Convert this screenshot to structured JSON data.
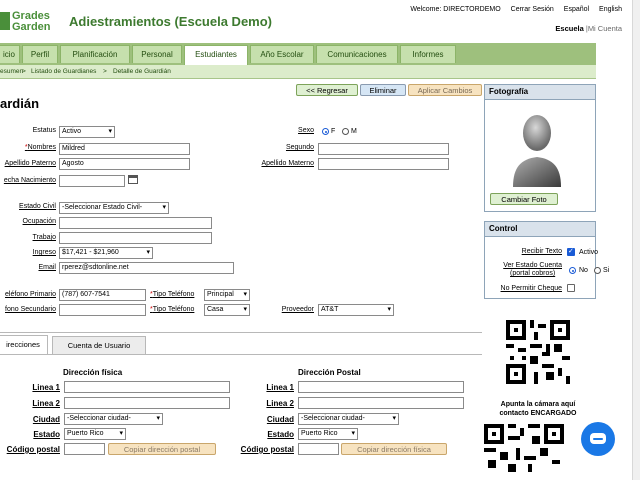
{
  "header": {
    "logo_line1": "Grades",
    "logo_line2": "Garden",
    "app_title": "Adiestramientos (Escuela Demo)",
    "welcome": "Welcome: DIRECTORDEMO",
    "logout": "Cerrar Sesión",
    "lang_es": "Español",
    "lang_en": "English",
    "school_label": "Escuela",
    "school_sep": "|",
    "school_link": "Mi Cuenta"
  },
  "nav": {
    "tabs": [
      "icio",
      "Perfil",
      "Planificación",
      "Personal",
      "Estudiantes",
      "Año Escolar",
      "Comunicaciones",
      "Informes"
    ],
    "active": "Estudiantes"
  },
  "breadcrumb": {
    "items": [
      "esumen",
      "Listado de Guardianes",
      "Detalle de Guardián"
    ],
    "sep": ">"
  },
  "page_title": "ardián",
  "actions": {
    "back": "<< Regresar",
    "delete": "Eliminar",
    "apply": "Aplicar Cambios"
  },
  "form": {
    "estatus_label": "Estatus",
    "estatus_value": "Activo",
    "nombres_label": "Nombres",
    "nombres_value": "Mildred",
    "apellido_paterno_label": "Apellido Paterno",
    "apellido_paterno_value": "Agosto",
    "fecha_nac_label": "echa Nacimiento",
    "fecha_nac_value": "",
    "sexo_label": "Sexo",
    "sexo_f": "F",
    "sexo_m": "M",
    "segundo_label": "Segundo",
    "apellido_materno_label": "Apellido Materno",
    "estado_civil_label": "Estado Civil",
    "estado_civil_value": "-Seleccionar Estado Civil-",
    "ocupacion_label": "Ocupación",
    "trabajo_label": "Trabajo",
    "ingreso_label": "Ingreso",
    "ingreso_value": "$17,421 - $21,960",
    "email_label": "Email",
    "email_value": "rperez@sdtonline.net",
    "tel_primario_label": "eléfono Primario",
    "tel_primario_value": "(787) 607-7541",
    "tipo_tel_label": "Tipo Teléfono",
    "tipo_tel1_value": "Principal",
    "tel_secundario_label": "fono Secundario",
    "tipo_tel2_value": "Casa",
    "proveedor_label": "Proveedor",
    "proveedor_value": "AT&T"
  },
  "photo_panel": {
    "title": "Fotografía",
    "change_button": "Cambiar Foto"
  },
  "control_panel": {
    "title": "Control",
    "recibir_texto_label": "Recibir Texto",
    "activo_label": "Activo",
    "ver_estado_label_1": "Ver Estado Cuenta",
    "ver_estado_label_2": "(portal cobros)",
    "no_label": "No",
    "si_label": "Si",
    "no_permitir_label": "No Permitir Cheque"
  },
  "address_tabs": {
    "tabs": [
      "irecciones",
      "Cuenta de Usuario"
    ],
    "active": "irecciones"
  },
  "address": {
    "fisica_title": "Dirección física",
    "postal_title": "Dirección Postal",
    "linea1_label": "Linea 1",
    "linea2_label": "Linea 2",
    "ciudad_label": "Ciudad",
    "ciudad_value": "-Seleccionar ciudad-",
    "estado_label": "Estado",
    "estado_value": "Puerto Rico",
    "codigo_label": "Código postal",
    "copy_postal": "Copiar dirección postal",
    "copy_fisica": "Copiar dirección física"
  },
  "qr": {
    "caption_1": "Apunta la cámara aquí",
    "caption_2": "contacto ENCARGADO"
  },
  "colors": {
    "brand_green": "#3d7a2f",
    "nav_green": "#9ec07d",
    "tab_green": "#c6e0ad",
    "chat_blue": "#1a78e6",
    "required_red": "#cc0000"
  }
}
